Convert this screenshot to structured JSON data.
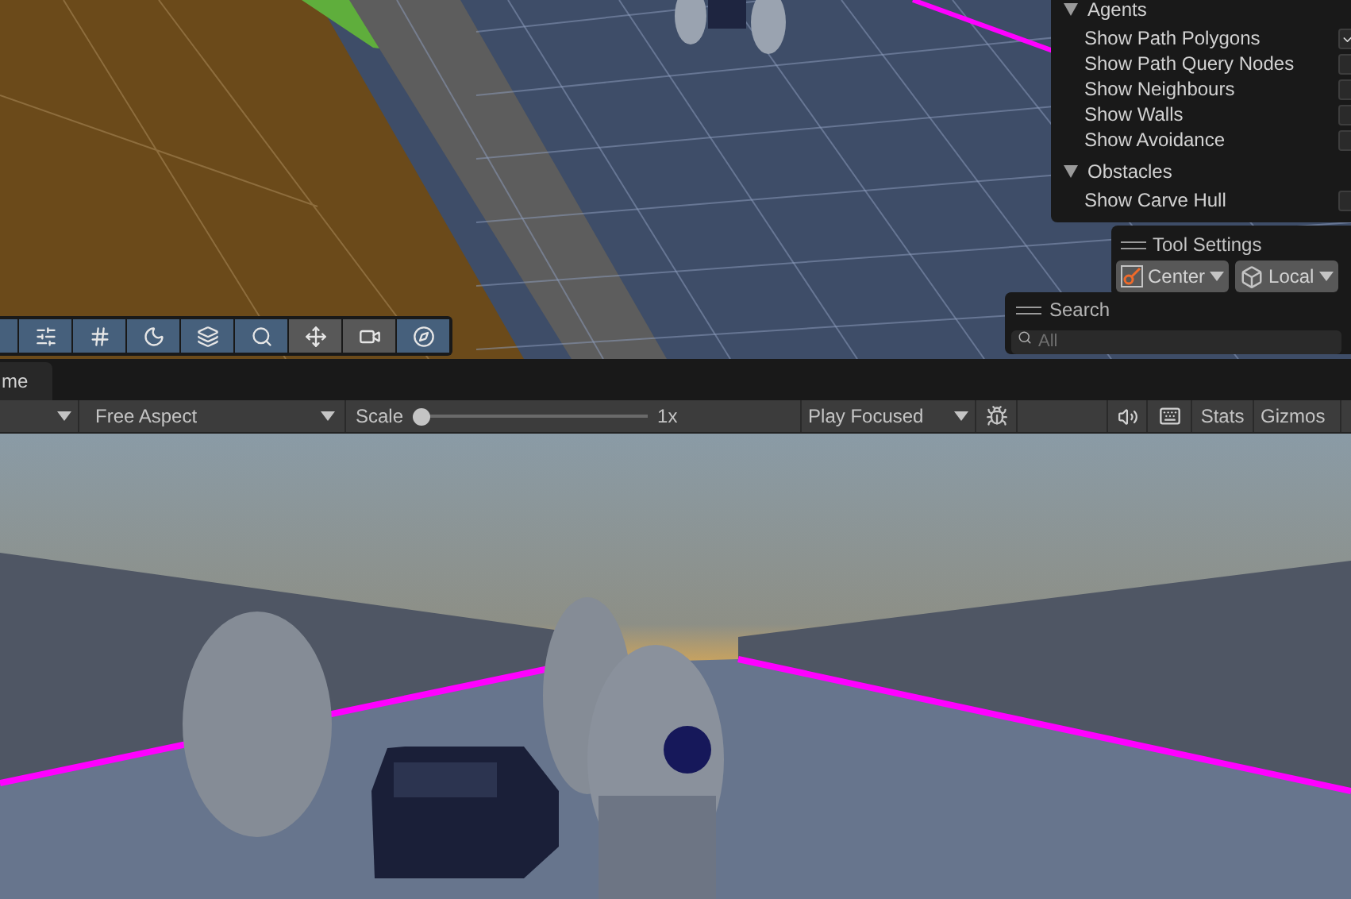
{
  "navigation_overlay": {
    "sections": [
      {
        "title": "Agents",
        "expanded": true,
        "items": [
          {
            "label": "Show Path Polygons",
            "checked": true
          },
          {
            "label": "Show Path Query Nodes",
            "checked": false
          },
          {
            "label": "Show Neighbours",
            "checked": false
          },
          {
            "label": "Show Walls",
            "checked": false
          },
          {
            "label": "Show Avoidance",
            "checked": false
          }
        ]
      },
      {
        "title": "Obstacles",
        "expanded": true,
        "items": [
          {
            "label": "Show Carve Hull",
            "checked": false
          }
        ]
      }
    ]
  },
  "tool_settings": {
    "title": "Tool Settings",
    "pivot": "Center",
    "space": "Local"
  },
  "search_overlay": {
    "title": "Search",
    "placeholder": "All"
  },
  "scene_toolbar": {
    "tools": [
      {
        "selected": true
      },
      {
        "selected": true
      },
      {
        "selected": true
      },
      {
        "selected": true
      },
      {
        "selected": true
      },
      {
        "selected": true
      },
      {
        "selected": false
      },
      {
        "selected": false
      },
      {
        "selected": true
      }
    ]
  },
  "game_tab": {
    "label": "me"
  },
  "game_toolbar": {
    "aspect": "Free Aspect",
    "scale_label": "Scale",
    "scale": {
      "level": 0.0
    },
    "scale_reading": "1x",
    "play_mode": "Play Focused",
    "stats": "Stats",
    "gizmos": "Gizmos"
  }
}
